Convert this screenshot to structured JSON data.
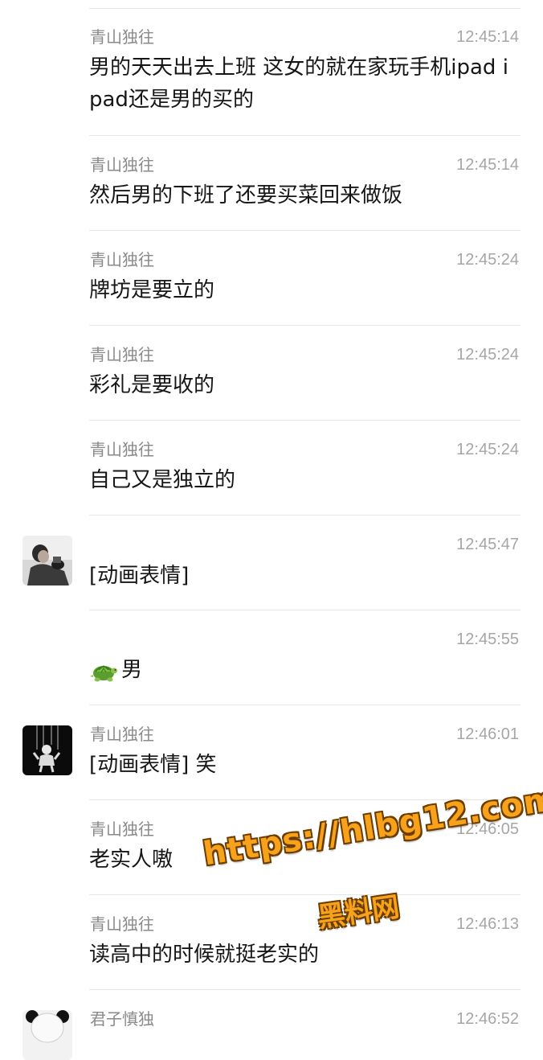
{
  "messages": [
    {
      "sender": "青山独往",
      "time": "12:45:14",
      "text": "男的天天出去上班 这女的就在家玩手机ipad ipad还是男的买的"
    },
    {
      "sender": "青山独往",
      "time": "12:45:14",
      "text": "然后男的下班了还要买菜回来做饭"
    },
    {
      "sender": "青山独往",
      "time": "12:45:24",
      "text": "牌坊是要立的"
    },
    {
      "sender": "青山独往",
      "time": "12:45:24",
      "text": "彩礼是要收的"
    },
    {
      "sender": "青山独往",
      "time": "12:45:24",
      "text": "自己又是独立的"
    },
    {
      "sender": "",
      "time": "12:45:47",
      "text": "[动画表情]"
    },
    {
      "sender": "",
      "time": "12:45:55",
      "text": "男",
      "emoji": "turtle-emoji"
    },
    {
      "sender": "青山独往",
      "time": "12:46:01",
      "text": "[动画表情] 笑"
    },
    {
      "sender": "青山独往",
      "time": "12:46:05",
      "text": "老实人嗷"
    },
    {
      "sender": "青山独往",
      "time": "12:46:13",
      "text": "读高中的时候就挺老实的"
    },
    {
      "sender": "君子慎独",
      "time": "12:46:52",
      "text": ""
    }
  ],
  "watermark": {
    "url": "https://hlbg12.com",
    "name": "黑料网",
    "color": "#f7a21a"
  },
  "colors": {
    "sender": "#8a8a8a",
    "time": "#a6a6a6",
    "text": "#161616",
    "separator": "#e6e6e6"
  }
}
